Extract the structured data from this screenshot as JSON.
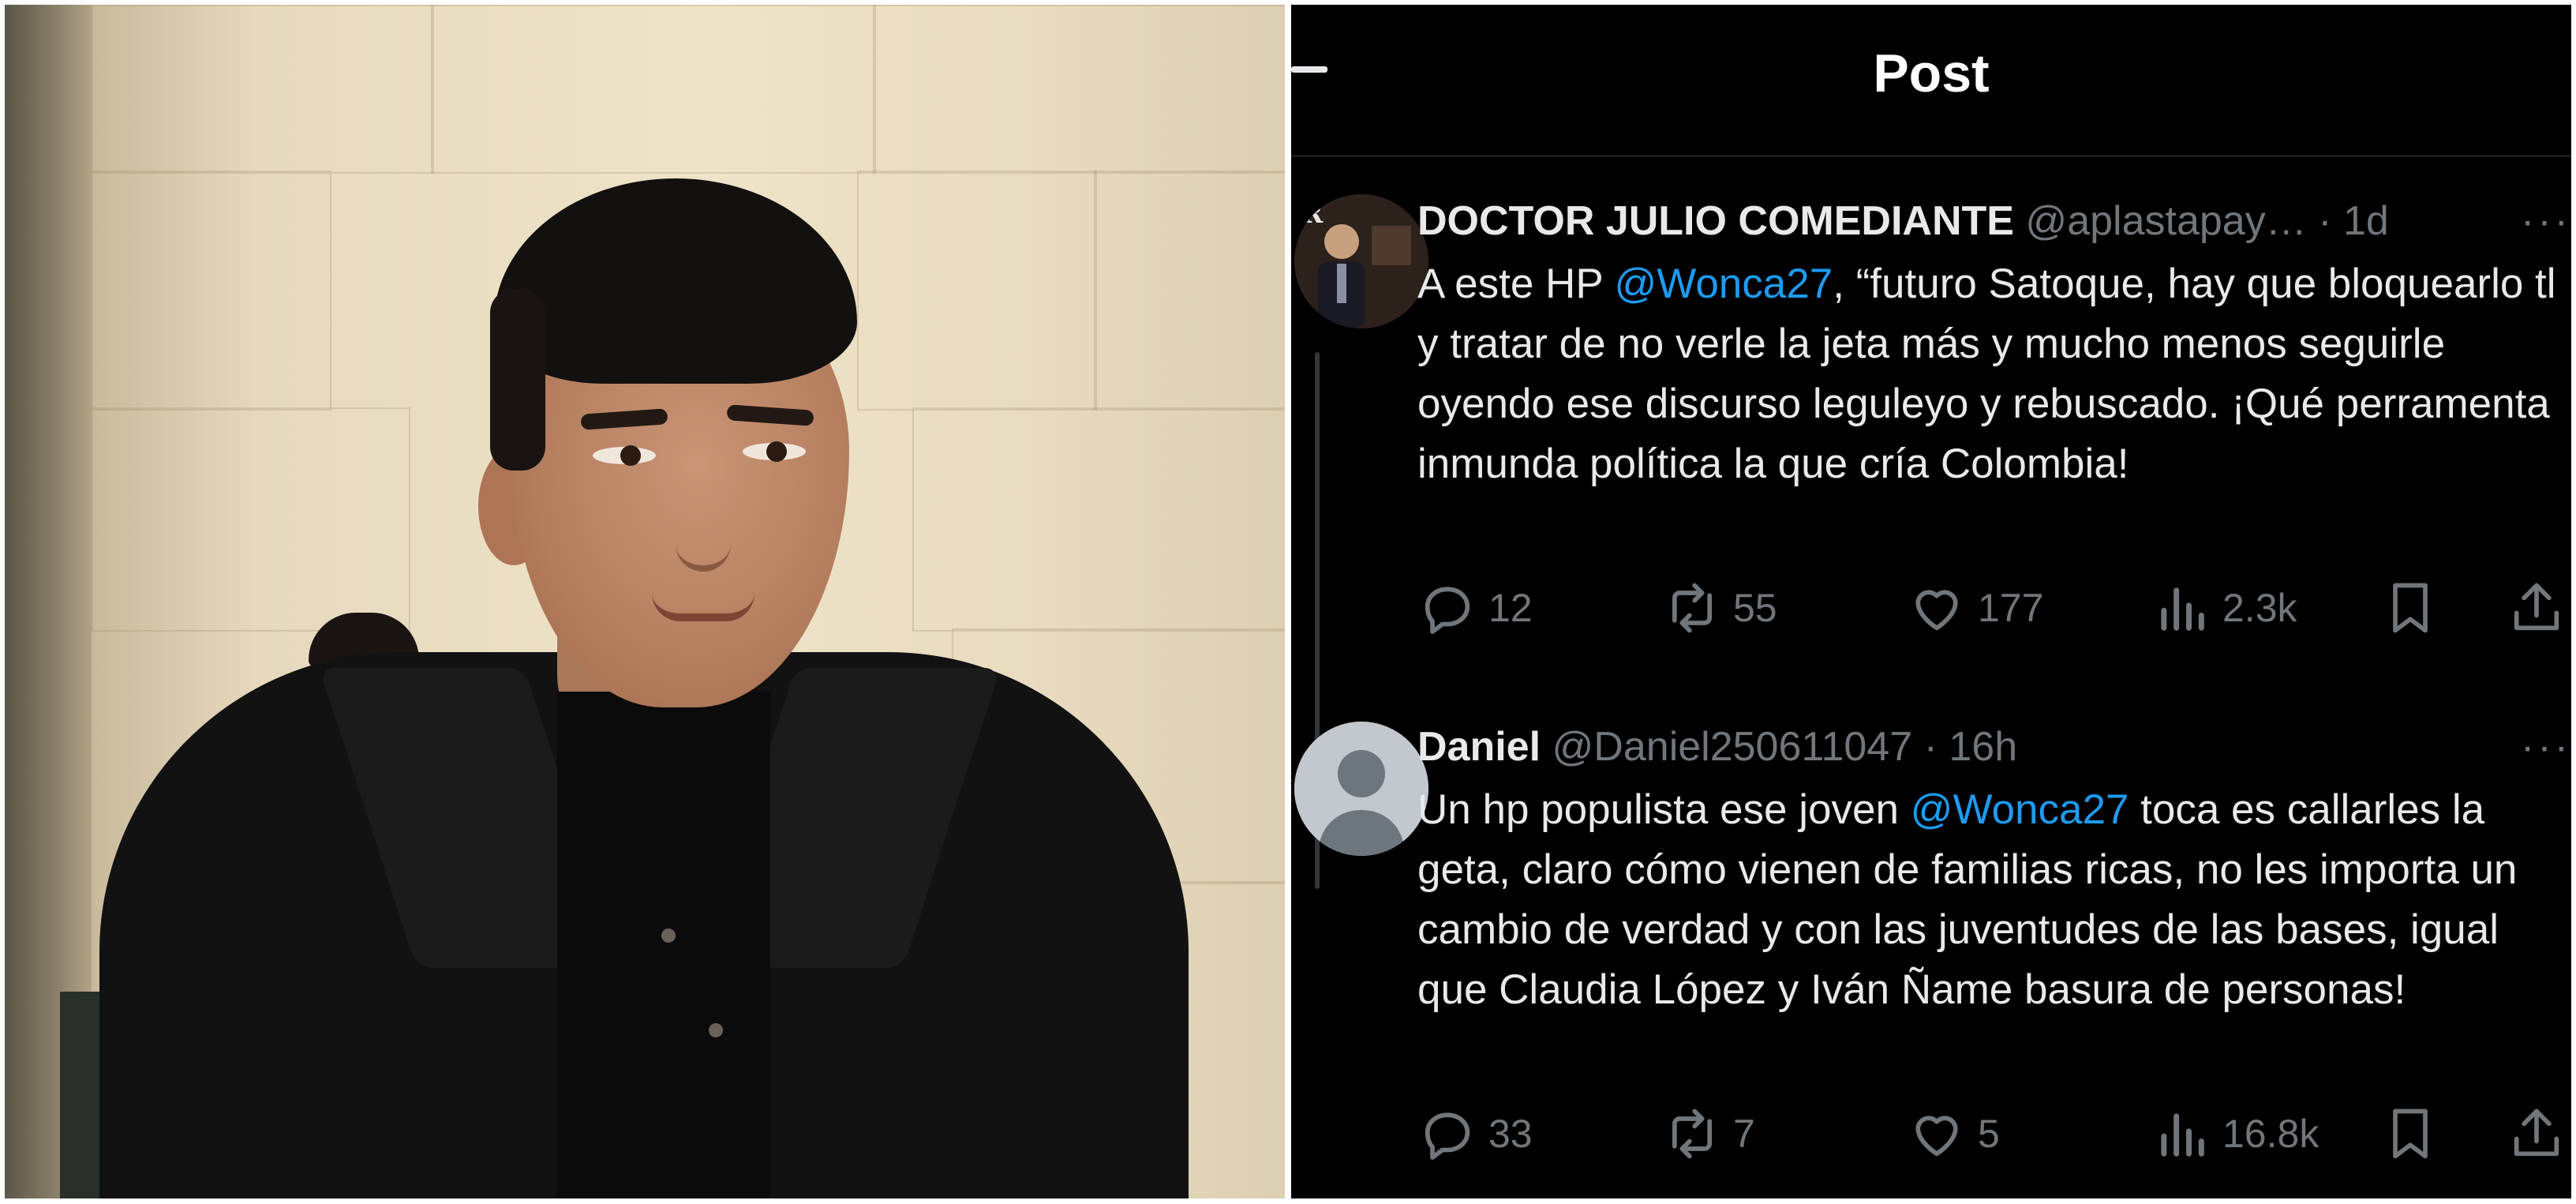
{
  "header": {
    "title": "Post"
  },
  "tweets": [
    {
      "name": "DOCTOR JULIO COMEDIANTE",
      "handle": "@aplastapay…",
      "time": "· 1d",
      "more": "···",
      "text": [
        {
          "t": "A este HP ",
          "mention": false
        },
        {
          "t": "@Wonca27",
          "mention": true
        },
        {
          "t": ", “futuro Satoque, hay que bloquearlo tl y tratar de no verle la jeta más y mucho menos seguirle oyendo ese discurso leguleyo y rebuscado. ¡Qué perramenta inmunda política la que cría Colombia!",
          "mention": false
        }
      ],
      "replies": "12",
      "reposts": "55",
      "likes": "177",
      "views": "2.3k"
    },
    {
      "name": "Daniel",
      "handle": "@Daniel250611047",
      "time": "· 16h",
      "more": "···",
      "text": [
        {
          "t": "Un hp populista  ese joven ",
          "mention": false
        },
        {
          "t": "@Wonca27",
          "mention": true
        },
        {
          "t": "  toca es callarles la geta, claro cómo vienen de familias ricas, no les importa un cambio de verdad y con las juventudes de las bases, igual que Claudia López y Iván Ñame basura  de personas!",
          "mention": false
        }
      ],
      "replies": "33",
      "reposts": "7",
      "likes": "5",
      "views": "16.8k"
    }
  ],
  "icons": {
    "reply": "reply-icon",
    "repost": "repost-icon",
    "like": "heart-icon",
    "views": "views-icon",
    "bookmark": "bookmark-icon",
    "share": "share-icon"
  },
  "colors": {
    "background": "#000000",
    "text": "#e7e9ea",
    "muted": "#71767b",
    "mention": "#1d9bf0"
  }
}
